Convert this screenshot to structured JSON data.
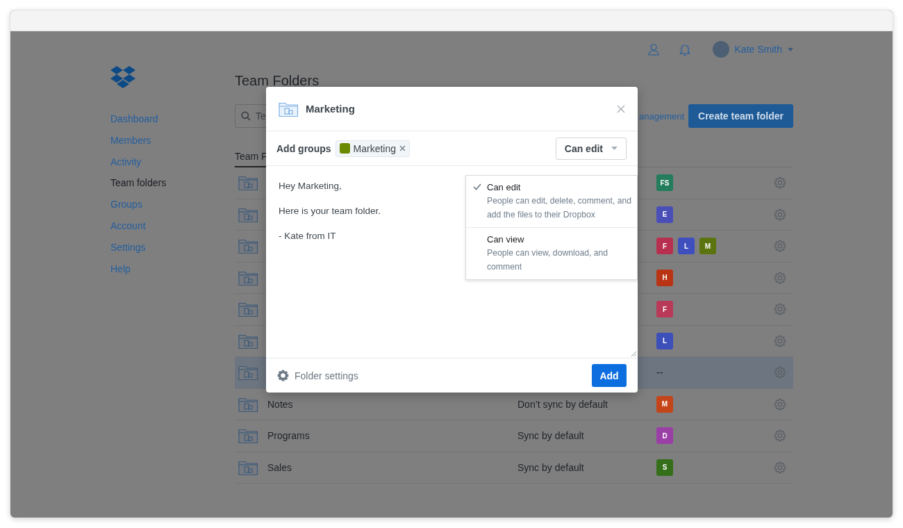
{
  "header": {
    "user_name": "Kate Smith"
  },
  "sidebar": {
    "items": [
      {
        "label": "Dashboard",
        "selected": false
      },
      {
        "label": "Members",
        "selected": false
      },
      {
        "label": "Activity",
        "selected": false
      },
      {
        "label": "Team folders",
        "selected": true
      },
      {
        "label": "Groups",
        "selected": false
      },
      {
        "label": "Account",
        "selected": false
      },
      {
        "label": "Settings",
        "selected": false
      },
      {
        "label": "Help",
        "selected": false
      }
    ]
  },
  "page": {
    "title": "Team Folders",
    "search": {
      "placeholder": "Te"
    },
    "link": "anagement",
    "create_button": "Create team folder"
  },
  "table": {
    "columns": [
      "Team F"
    ],
    "rows": [
      {
        "selected": false,
        "badges": [
          {
            "text": "FS",
            "color": "#237c5c"
          }
        ]
      },
      {
        "selected": false,
        "badges": [
          {
            "text": "E",
            "color": "#4a4fb8"
          }
        ]
      },
      {
        "selected": false,
        "badges": [
          {
            "text": "F",
            "color": "#b8304f"
          },
          {
            "text": "L",
            "color": "#3f4fbd"
          },
          {
            "text": "M",
            "color": "#5c7410"
          }
        ]
      },
      {
        "selected": false,
        "badges": [
          {
            "text": "H",
            "color": "#b83414"
          }
        ]
      },
      {
        "selected": false,
        "badges": [
          {
            "text": "F",
            "color": "#b83a58"
          }
        ]
      },
      {
        "selected": false,
        "badges": [
          {
            "text": "L",
            "color": "#3d4fb8"
          }
        ]
      },
      {
        "selected": true,
        "members_text": "--",
        "badges": []
      },
      {
        "selected": false,
        "name": "Notes",
        "sync": "Don’t sync by default",
        "badges": [
          {
            "text": "M",
            "color": "#c4451a"
          }
        ]
      },
      {
        "selected": false,
        "name": "Programs",
        "sync": "Sync by default",
        "badges": [
          {
            "text": "D",
            "color": "#9a3fa6"
          }
        ]
      },
      {
        "selected": false,
        "name": "Sales",
        "sync": "Sync by default",
        "badges": [
          {
            "text": "S",
            "color": "#356f1a"
          }
        ]
      }
    ]
  },
  "modal": {
    "title": "Marketing",
    "add_groups_label": "Add groups",
    "groups": [
      {
        "label": "Marketing",
        "color": "#6b8a00"
      }
    ],
    "permission": "Can edit",
    "message": "Hey Marketing,\n\nHere is your team folder.\n\n- Kate from IT",
    "permission_menu": {
      "options": [
        {
          "label": "Can edit",
          "description": "People can edit, delete, comment, and add the files to their Dropbox",
          "selected": true
        },
        {
          "label": "Can view",
          "description": "People can view, download, and comment",
          "selected": false
        }
      ]
    },
    "settings_link": "Folder settings",
    "add_button": "Add"
  }
}
